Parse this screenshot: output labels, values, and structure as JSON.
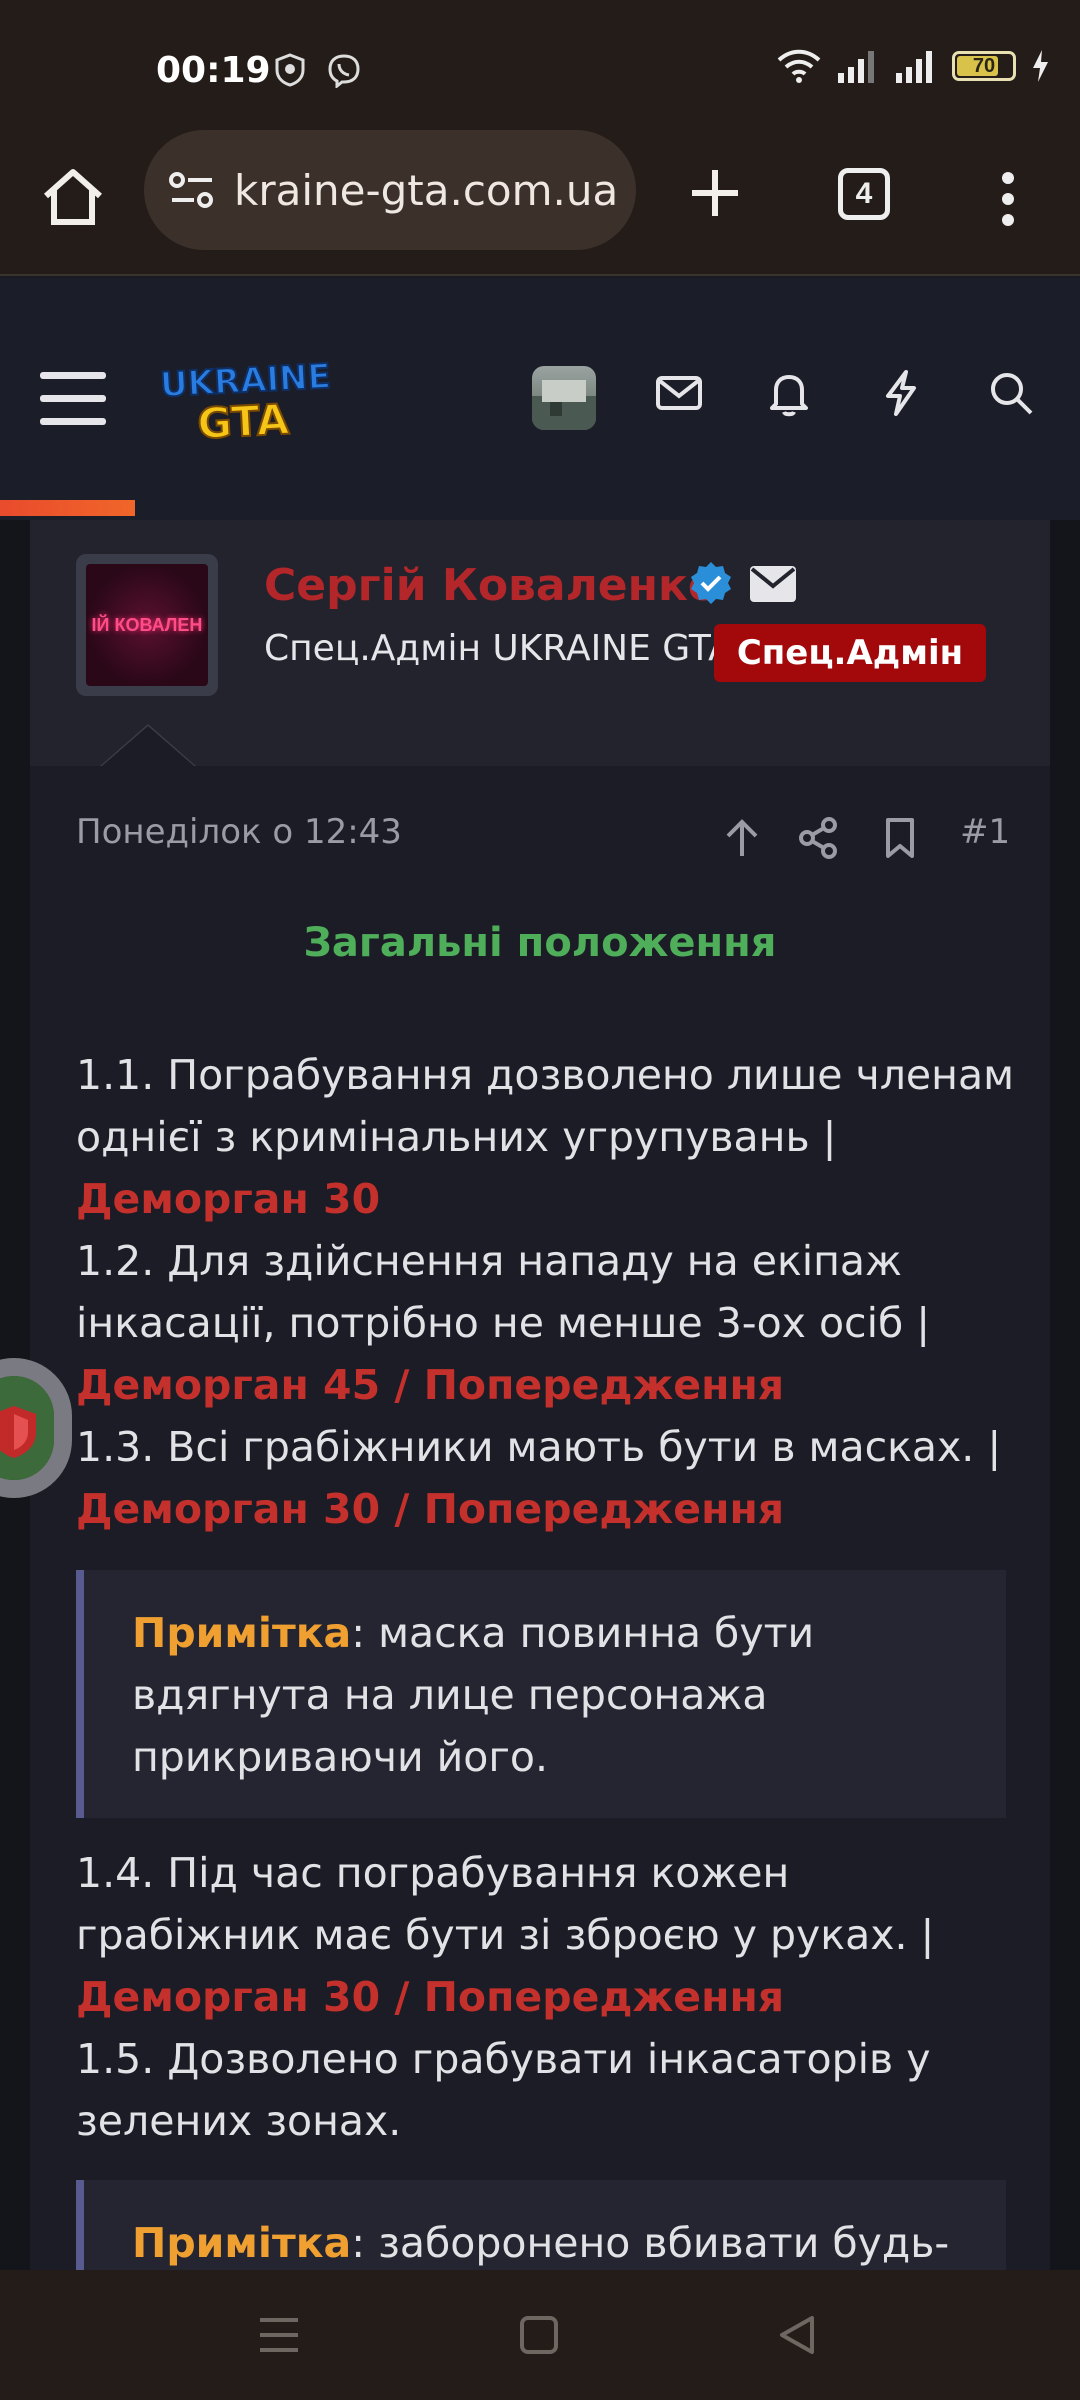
{
  "status": {
    "time": "00:19",
    "battery": "70"
  },
  "browser": {
    "url": "kraine-gta.com.ua",
    "tab_count": "4"
  },
  "post": {
    "author": "Сергій Коваленко",
    "avatar_text": "ІЙ КОВАЛЕН",
    "user_title": "Спец.Адмін UKRAINE GTA",
    "role_badge": "Спец.Адмін",
    "date": "Понеділок о 12:43",
    "post_number": "#1",
    "section_title": "Загальні положення",
    "rules": {
      "r1_text": "1.1. Пограбування дозволено лише членам однієї з кримінальних угрупувань |",
      "r1_penalty": "Деморган 30",
      "r2_text": "1.2. Для здійснення нападу на екіпаж інкасації, потрібно не менше 3-ох осіб |",
      "r2_penalty": "Деморган 45 / Попередження",
      "r3_text": "1.3. Всі грабіжники мають бути в масках. |",
      "r3_penalty": "Деморган 30 / Попередження",
      "note1_label": "Примітка",
      "note1_text": ": маска повинна бути вдягнута на лице персонажа прикриваючи його.",
      "r4_text": "1.4. Під час пограбування кожен грабіжник має бути зі зброєю у руках. |",
      "r4_penalty": "Деморган 30 / Попередження",
      "r5_text": "1.5. Дозволено грабувати інкасаторів у зелених зонах.",
      "note2_label": "Примітка",
      "note2_text": ": заборонено вбивати будь-"
    }
  },
  "logo": {
    "line1": "UKRAINE",
    "line2": "GTA"
  },
  "colors": {
    "accent_red": "#c4302b",
    "section_green": "#4fae5a",
    "note_orange": "#f0a030",
    "badge_red": "#a3090b"
  }
}
